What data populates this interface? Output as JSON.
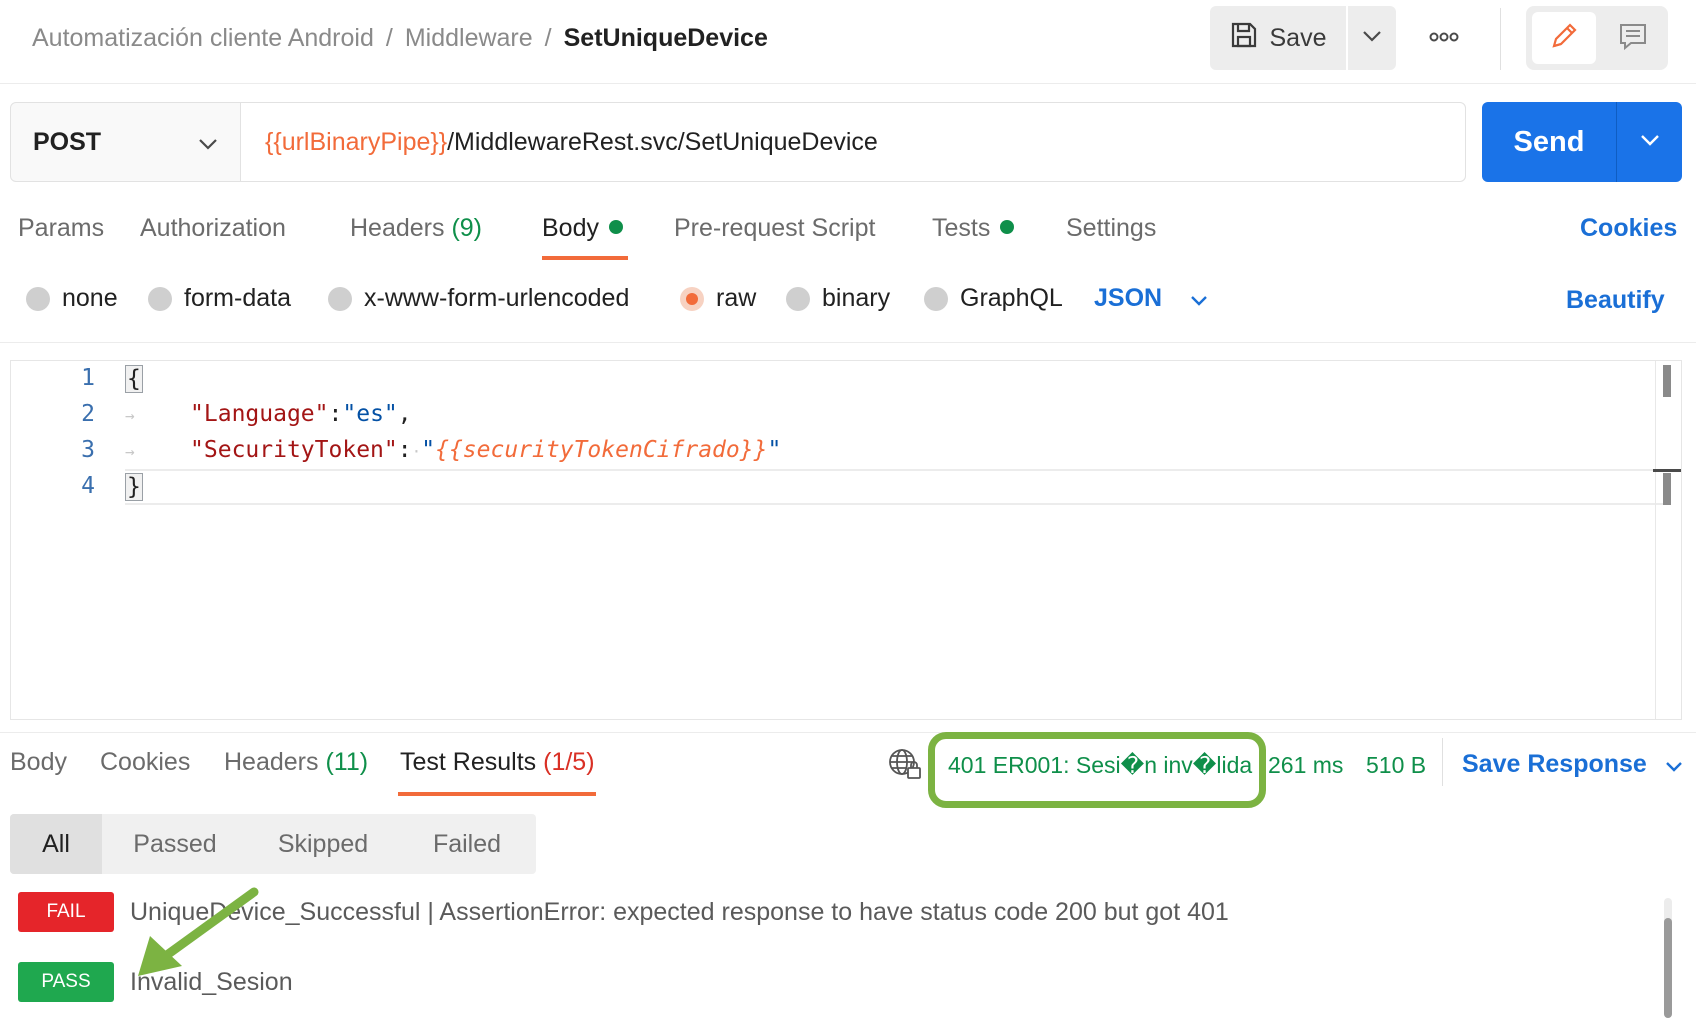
{
  "breadcrumb": {
    "workspace": "Automatización cliente Android",
    "folder": "Middleware",
    "separator": "/",
    "request": "SetUniqueDevice"
  },
  "toolbar": {
    "save_label": "Save",
    "save_icon": "floppy-disk-icon",
    "more_icon": "ellipsis-icon",
    "edit_icon": "pencil-icon",
    "comment_icon": "comment-icon"
  },
  "request": {
    "method": "POST",
    "url_variable": "{{urlBinaryPipe}}",
    "url_path": "/MiddlewareRest.svc/SetUniqueDevice",
    "send_label": "Send"
  },
  "request_tabs": {
    "params": "Params",
    "authorization": "Authorization",
    "headers": "Headers",
    "headers_count": "(9)",
    "body": "Body",
    "prerequest": "Pre-request Script",
    "tests": "Tests",
    "settings": "Settings",
    "cookies": "Cookies",
    "active": "Body"
  },
  "body_types": {
    "none": "none",
    "form_data": "form-data",
    "urlencoded": "x-www-form-urlencoded",
    "raw": "raw",
    "binary": "binary",
    "graphql": "GraphQL",
    "selected": "raw",
    "format": "JSON",
    "beautify": "Beautify"
  },
  "editor": {
    "line_numbers": [
      "1",
      "2",
      "3",
      "4"
    ],
    "open_brace": "{",
    "close_brace": "}",
    "line2_key": "\"Language\"",
    "line2_colon": ":",
    "line2_value": "\"es\"",
    "line2_comma": ",",
    "line3_key": "\"SecurityToken\"",
    "line3_colon": ":",
    "line3_quote_open": "\"",
    "line3_variable": "{{securityTokenCifrado}}",
    "line3_quote_close": "\""
  },
  "response_tabs": {
    "body": "Body",
    "cookies": "Cookies",
    "headers": "Headers",
    "headers_count": "(11)",
    "test_results": "Test Results",
    "test_results_count": "(1/5)",
    "active": "Test Results"
  },
  "response_meta": {
    "status": "401 ER001: Sesi�n inv�lida",
    "time": "261 ms",
    "size": "510 B",
    "save_response": "Save Response",
    "network_icon": "globe-lock-icon"
  },
  "filter": {
    "options": [
      "All",
      "Passed",
      "Skipped",
      "Failed"
    ],
    "selected": "All"
  },
  "results": [
    {
      "status": "FAIL",
      "text": "UniqueDevice_Successful | AssertionError: expected response to have status code 200 but got 401"
    },
    {
      "status": "PASS",
      "text": "Invalid_Sesion"
    }
  ],
  "colors": {
    "accent_orange": "#f26b3a",
    "primary_blue": "#1a73e8",
    "link_blue": "#1a6fd6",
    "success_green": "#0f8f4a",
    "fail_red": "#e5252a",
    "pass_green": "#1fa84f",
    "annotation_green": "#7cb342"
  }
}
